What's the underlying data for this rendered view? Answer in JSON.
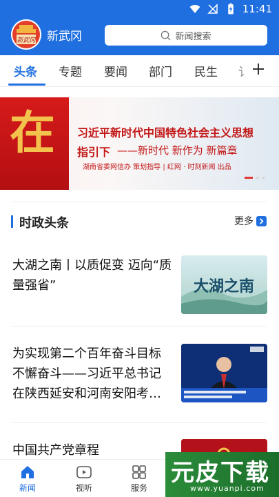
{
  "status_bar": {
    "time": "11:41",
    "icons": [
      "wifi-icon",
      "no-signal-icon",
      "battery-charging-icon"
    ]
  },
  "header": {
    "app_title": "新武冈",
    "logo_text": "新武冈",
    "search_placeholder": "新闻搜索"
  },
  "tabs": [
    {
      "label": "头条",
      "active": true
    },
    {
      "label": "专题",
      "active": false
    },
    {
      "label": "要闻",
      "active": false
    },
    {
      "label": "部门",
      "active": false
    },
    {
      "label": "民生",
      "active": false
    },
    {
      "label": "讠",
      "active": false
    }
  ],
  "banner": {
    "big_char": "在",
    "line1": "习近平新时代中国特色社会主义思想",
    "line2_bold": "指引下",
    "line2_rest": "——新时代  新作为  新篇章",
    "line3": "湖南省委网信办  策划指导  |  红网 · 时刻新闻  出品",
    "slides": 3,
    "active_slide": 1
  },
  "section": {
    "title": "时政头条",
    "more_label": "更多"
  },
  "news": [
    {
      "title": "大湖之南丨以质促变 迈向“质量强省”",
      "thumb_text": "大湖之南"
    },
    {
      "title": "为实现第二个百年奋斗目标不懈奋斗——习近平总书记在陕西延安和河南安阳考…",
      "thumb_text": "新闻联播"
    },
    {
      "title": "中国共产党章程",
      "thumb_text": ""
    }
  ],
  "bottom_nav": [
    {
      "label": "新闻",
      "icon": "home-icon",
      "active": true
    },
    {
      "label": "视听",
      "icon": "play-icon",
      "active": false
    },
    {
      "label": "服务",
      "icon": "grid-icon",
      "active": false
    }
  ],
  "watermark": {
    "main": "元皮下载",
    "sub": "www.yuanpi.com"
  },
  "colors": {
    "brand_blue": "#1f6fe0",
    "banner_red": "#c31818"
  }
}
